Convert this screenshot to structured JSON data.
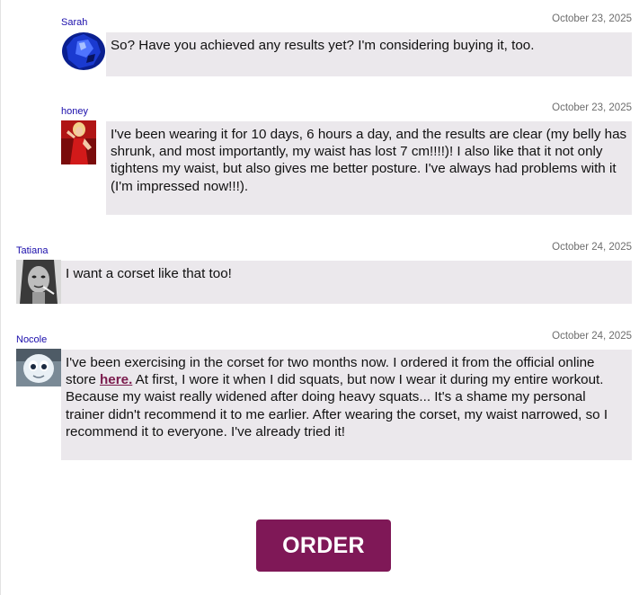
{
  "comments": [
    {
      "user": "Sarah",
      "date": "October 23, 2025",
      "avatar_icon": "blue-gem-avatar",
      "text": "So? Have you achieved any results yet? I'm considering buying it, too."
    },
    {
      "user": "honey",
      "date": "October 23, 2025",
      "avatar_icon": "red-dress-woman-avatar",
      "text": "I've been wearing it for 10 days, 6 hours a day, and the results are clear (my belly has shrunk, and most importantly, my waist has lost 7 cm!!!!)! I also like that it not only tightens my waist, but also gives me better posture. I've always had problems with it (I'm impressed now!!!)."
    },
    {
      "user": "Tatiana",
      "date": "October 24, 2025",
      "avatar_icon": "woman-portrait-avatar",
      "text": "I want a corset like that too!"
    },
    {
      "user": "Nocole",
      "date": "October 24, 2025",
      "avatar_icon": "cartoon-ghost-avatar",
      "text_before": "I've been exercising in the corset for two months now. I ordered it from the official online store ",
      "link": "here.",
      "text_after": " At first, I wore it when I did squats, but now I wear it during my entire workout. Because my waist really widened after doing heavy squats... It's a shame my personal trainer didn't recommend it to me earlier. After wearing the corset, my waist narrowed, so I recommend it to everyone. I've already tried it!"
    }
  ],
  "order_button": "ORDER",
  "colors": {
    "bubble": "#ebe8ec",
    "username": "#1a0dab",
    "date": "#6d6d6d",
    "button": "#7f1857",
    "link": "#7a1a4c"
  }
}
